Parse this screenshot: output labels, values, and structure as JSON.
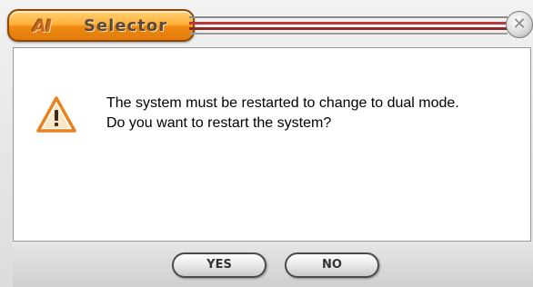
{
  "window": {
    "title": "Selector",
    "logo_text": "AI",
    "close_glyph": "✕"
  },
  "dialog": {
    "icon": "warning-triangle-icon",
    "message_line1": "The system must be restarted to change to dual mode.",
    "message_line2": "Do you want to restart the system?"
  },
  "buttons": {
    "yes_label": "YES",
    "no_label": "NO"
  },
  "colors": {
    "title_accent": "#f08a12",
    "rail_red": "#b83a3a",
    "warning_orange": "#e8821e"
  }
}
